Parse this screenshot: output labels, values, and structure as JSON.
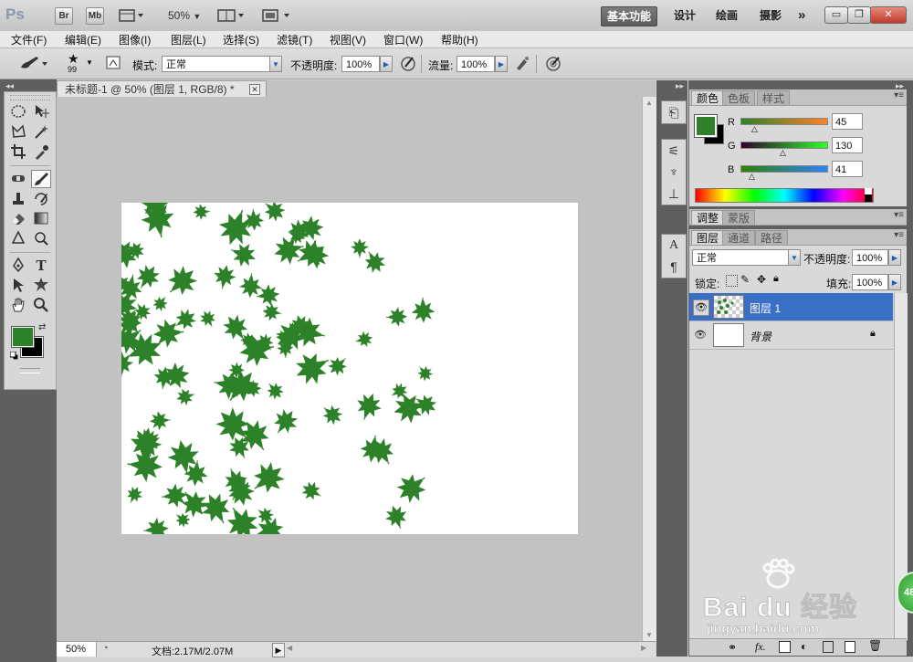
{
  "titlebar": {
    "logo": "Ps",
    "br": "Br",
    "mb": "Mb",
    "zoom": "50%",
    "workspaces": [
      "基本功能",
      "设计",
      "绘画",
      "摄影"
    ],
    "more": "»"
  },
  "menubar": [
    "文件(F)",
    "编辑(E)",
    "图像(I)",
    "图层(L)",
    "选择(S)",
    "滤镜(T)",
    "视图(V)",
    "窗口(W)",
    "帮助(H)"
  ],
  "options": {
    "brush_size": "99",
    "mode_label": "模式:",
    "mode_value": "正常",
    "opacity_label": "不透明度:",
    "opacity_value": "100%",
    "flow_label": "流量:",
    "flow_value": "100%"
  },
  "document": {
    "tab_title": "未标题-1 @ 50% (图层 1, RGB/8) *",
    "zoom": "50%",
    "status": "文档:2.17M/2.07M",
    "leaf_color": "#2d8229"
  },
  "color_panel": {
    "tabs": [
      "颜色",
      "色板",
      "样式"
    ],
    "channels": [
      {
        "label": "R",
        "value": "45"
      },
      {
        "label": "G",
        "value": "130"
      },
      {
        "label": "B",
        "value": "41"
      }
    ],
    "foreground": "#2d8229",
    "background": "#000000"
  },
  "adjust_panel": {
    "tabs": [
      "调整",
      "蒙版"
    ]
  },
  "layers_panel": {
    "tabs": [
      "图层",
      "通道",
      "路径"
    ],
    "blend_mode": "正常",
    "opacity_label": "不透明度:",
    "opacity_value": "100%",
    "lock_label": "锁定:",
    "fill_label": "填充:",
    "fill_value": "100%",
    "layers": [
      {
        "name": "图层 1",
        "selected": true
      },
      {
        "name": "背景",
        "selected": false,
        "locked": true
      }
    ]
  },
  "watermark": {
    "brand": "Bai du 经验",
    "url": "jingyan.baidu.com",
    "badge": "48"
  }
}
